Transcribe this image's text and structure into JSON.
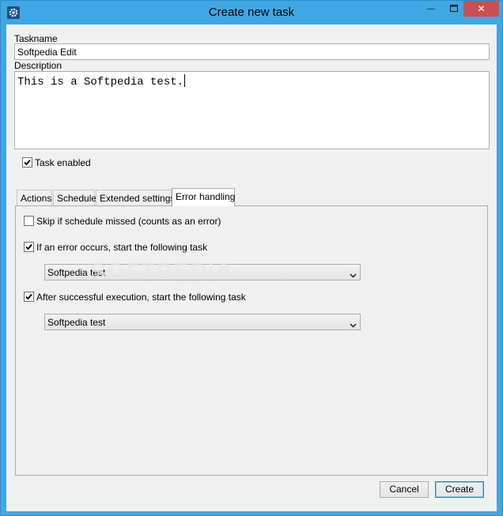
{
  "window": {
    "title": "Create new task",
    "minimize_glyph": "—",
    "close_glyph": "✕"
  },
  "form": {
    "taskname_label": "Taskname",
    "taskname_value": "Softpedia Edit",
    "description_label": "Description",
    "description_value": "This is a Softpedia test.",
    "task_enabled_label": "Task enabled",
    "task_enabled_checked": true
  },
  "tabs": [
    {
      "label": "Actions",
      "active": false
    },
    {
      "label": "Schedule",
      "active": false
    },
    {
      "label": "Extended settings",
      "active": false
    },
    {
      "label": "Error handling",
      "active": true
    }
  ],
  "error_handling": {
    "skip_label": "Skip if schedule missed (counts as an error)",
    "skip_checked": false,
    "on_error_label": "If an error occurs, start the following task",
    "on_error_checked": true,
    "on_error_task": "Softpedia test",
    "on_success_label": "After successful execution, start the following task",
    "on_success_checked": true,
    "on_success_task": "Softpedia test"
  },
  "buttons": {
    "cancel": "Cancel",
    "create": "Create"
  },
  "watermark": "SOFTPEDIA",
  "colors": {
    "titlebar": "#3fa7e3",
    "close_button": "#c75050",
    "panel": "#f0f0f0"
  }
}
